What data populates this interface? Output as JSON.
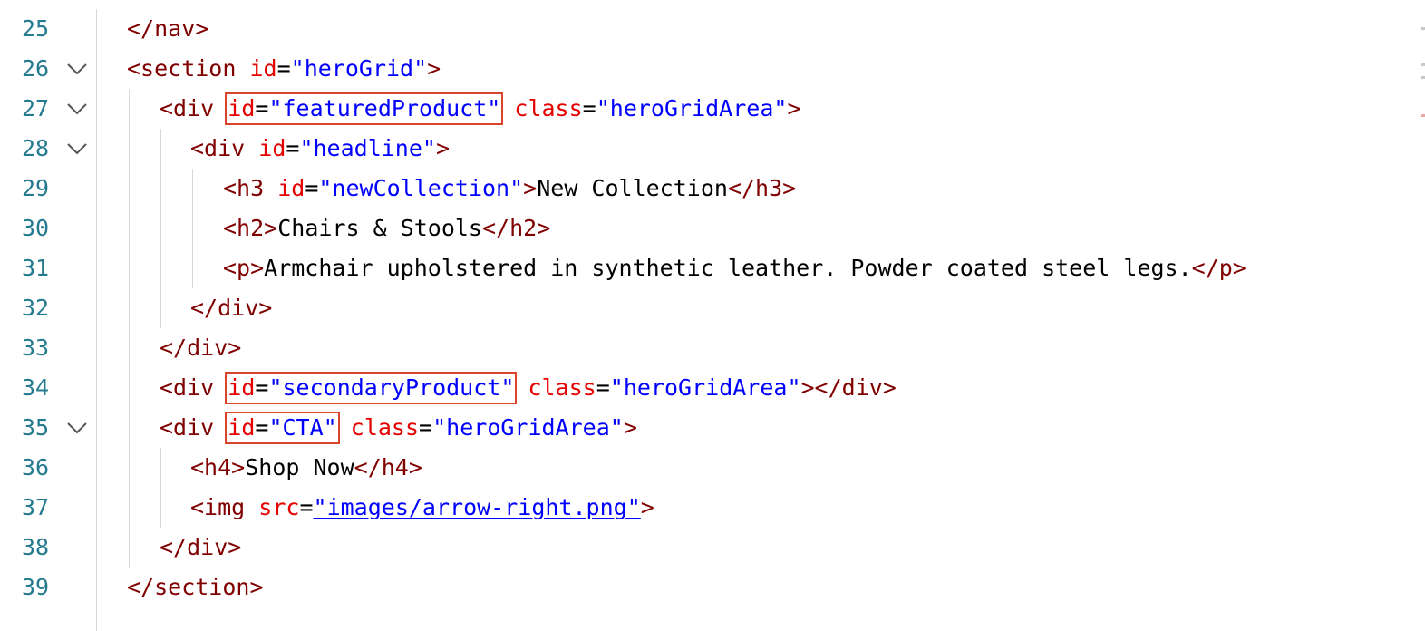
{
  "editor": {
    "lines": [
      {
        "num": "25",
        "t1": "</nav>"
      },
      {
        "num": "26",
        "t1": "<section",
        "a1": " id",
        "e1": "=",
        "v1": "\"heroGrid\"",
        "c1": ">"
      },
      {
        "num": "27",
        "t1": "<div",
        "sp": " ",
        "a1": "id",
        "e1": "=",
        "v1": "\"featuredProduct\"",
        "sp2": " ",
        "a2": "class",
        "e2": "=",
        "v2": "\"heroGridArea\"",
        "c1": ">"
      },
      {
        "num": "28",
        "t1": "<div",
        "a1": " id",
        "e1": "=",
        "v1": "\"headline\"",
        "c1": ">"
      },
      {
        "num": "29",
        "t1": "<h3",
        "a1": " id",
        "e1": "=",
        "v1": "\"newCollection\"",
        "c1": ">",
        "x1": "New Collection",
        "t2": "</h3>"
      },
      {
        "num": "30",
        "t1": "<h2>",
        "x1": "Chairs & Stools",
        "t2": "</h2>"
      },
      {
        "num": "31",
        "t1": "<p>",
        "x1": "Armchair upholstered in synthetic leather. Powder coated steel legs.",
        "t2": "</p>"
      },
      {
        "num": "32",
        "t1": "</div>"
      },
      {
        "num": "33",
        "t1": "</div>"
      },
      {
        "num": "34",
        "t1": "<div",
        "sp": " ",
        "a1": "id",
        "e1": "=",
        "v1": "\"secondaryProduct\"",
        "sp2": " ",
        "a2": "class",
        "e2": "=",
        "v2": "\"heroGridArea\"",
        "c1": "></div>"
      },
      {
        "num": "35",
        "t1": "<div",
        "sp": " ",
        "a1": "id",
        "e1": "=",
        "v1": "\"CTA\"",
        "sp2": " ",
        "a2": "class",
        "e2": "=",
        "v2": "\"heroGridArea\"",
        "c1": ">"
      },
      {
        "num": "36",
        "t1": "<h4>",
        "x1": "Shop Now",
        "t2": "</h4>"
      },
      {
        "num": "37",
        "t1": "<img",
        "a1": " src",
        "e1": "=",
        "q1": "\"",
        "v1": "images/arrow-right.png",
        "q2": "\"",
        "c1": ">"
      },
      {
        "num": "38",
        "t1": "</div>"
      },
      {
        "num": "39",
        "t1": "</section>"
      }
    ]
  },
  "colors": {
    "tag": "#800000",
    "attribute": "#e50000",
    "value": "#0000ff",
    "line_number": "#247a8e",
    "highlight_box": "#d9442a"
  },
  "icons": {
    "fold": "chevron-down-icon"
  }
}
